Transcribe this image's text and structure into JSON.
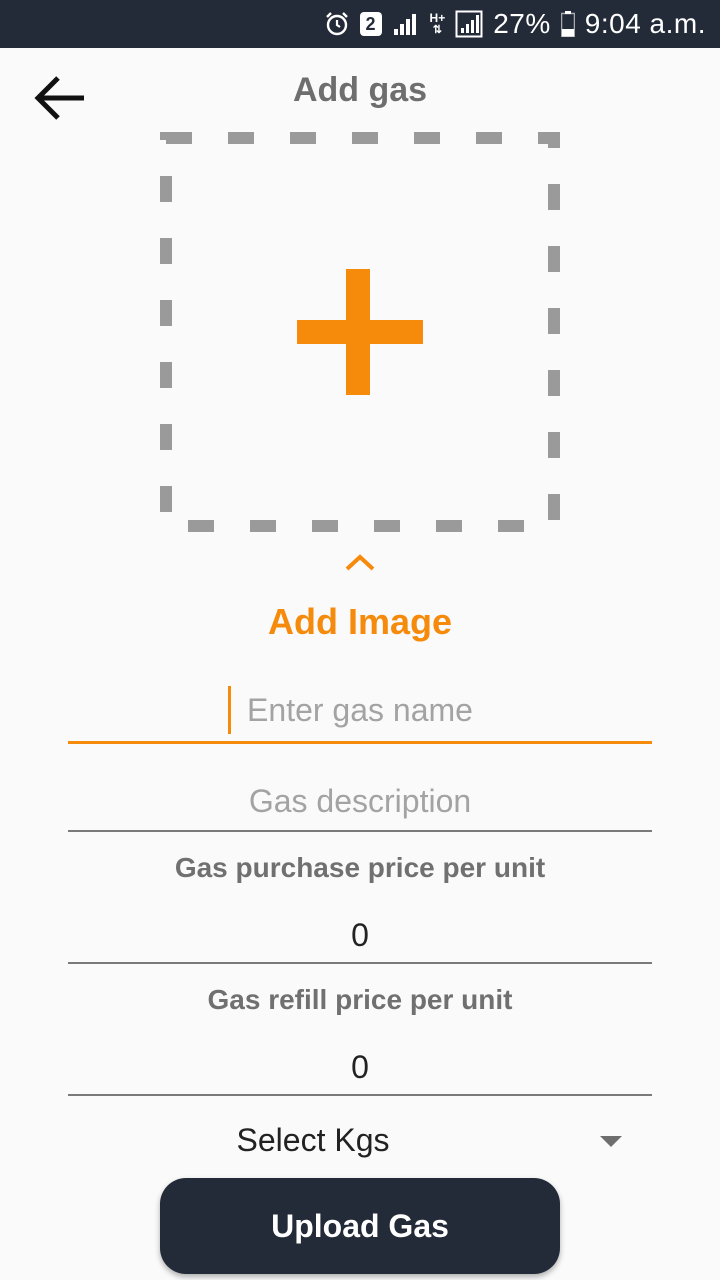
{
  "status_bar": {
    "sim_badge": "2",
    "network_label": "H+",
    "battery": "27%",
    "time": "9:04 a.m."
  },
  "header": {
    "title": "Add gas"
  },
  "image_picker": {
    "label": "Add Image",
    "accent_color": "#f58a0b"
  },
  "form": {
    "name": {
      "placeholder": "Enter gas name",
      "value": ""
    },
    "description": {
      "placeholder": "Gas description",
      "value": ""
    },
    "purchase_price": {
      "label": "Gas purchase price per unit",
      "value": "0"
    },
    "refill_price": {
      "label": "Gas refill price per unit",
      "value": "0"
    },
    "kgs_select": {
      "selected": "Select Kgs"
    }
  },
  "actions": {
    "upload_label": "Upload Gas"
  },
  "colors": {
    "accent": "#f58a0b",
    "dark": "#232a38"
  }
}
